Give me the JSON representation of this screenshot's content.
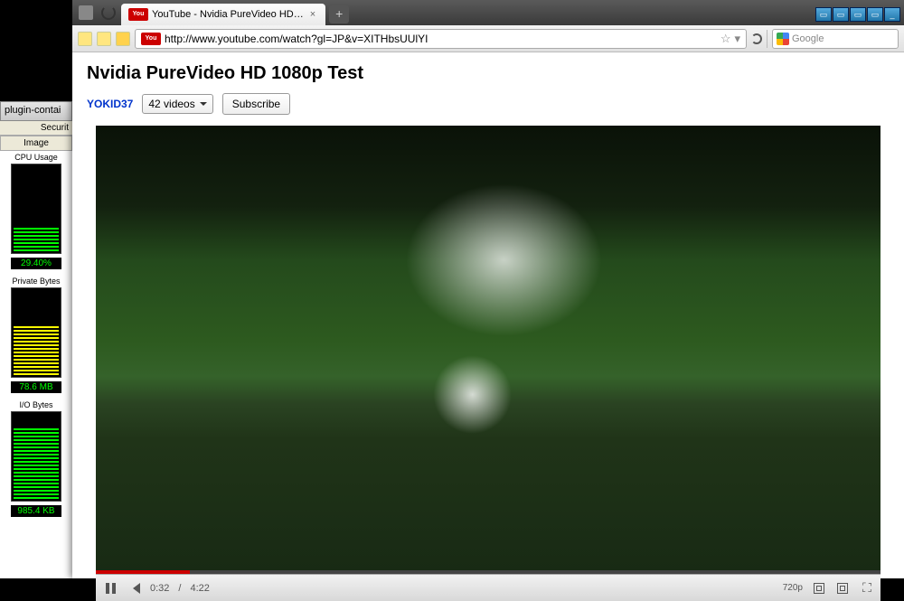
{
  "taskbar": {
    "item": "plugin-contai"
  },
  "procexp": {
    "header_right": "Securit",
    "col": "Image",
    "meters": [
      {
        "label": "CPU Usage",
        "value": "29.40%",
        "fill": 30,
        "color": "g"
      },
      {
        "label": "Private Bytes",
        "value": "78.6 MB",
        "fill": 60,
        "color": "y"
      },
      {
        "label": "I/O Bytes",
        "value": "985.4 KB",
        "fill": 85,
        "color": "g"
      }
    ]
  },
  "browser": {
    "tab_title": "YouTube - Nvidia PureVideo HD…",
    "url": "http://www.youtube.com/watch?gl=JP&v=XITHbsUUlYI",
    "search_placeholder": "Google",
    "yt_badge": "You"
  },
  "video": {
    "title": "Nvidia PureVideo HD 1080p Test",
    "channel": "YOKID37",
    "video_count": "42 videos",
    "subscribe": "Subscribe",
    "elapsed": "0:32",
    "duration": "4:22",
    "progress_pct": 12,
    "quality": "720p"
  }
}
